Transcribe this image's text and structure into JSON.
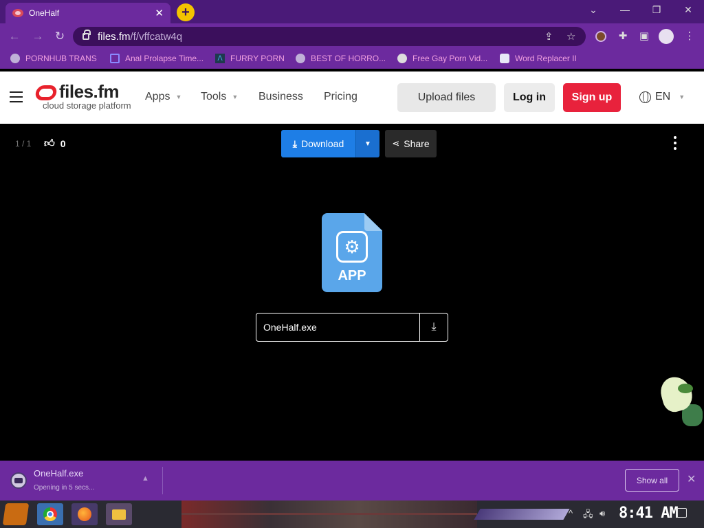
{
  "browser": {
    "tab_title": "OneHalf",
    "tab_close": "✕",
    "new_tab": "+",
    "url_host": "files.fm",
    "url_path": "/f/vffcatw4q"
  },
  "bookmarks": [
    {
      "label": "PORNHUB TRANS",
      "icon": "globe-icon"
    },
    {
      "label": "Anal Prolapse Time...",
      "icon": "bookmark-icon"
    },
    {
      "label": "FURRY PORN",
      "icon": "lambda-icon"
    },
    {
      "label": "BEST OF HORRO...",
      "icon": "globe-icon"
    },
    {
      "label": "Free Gay Porn Vid...",
      "icon": "site-icon"
    },
    {
      "label": "Word Replacer II",
      "icon": "extension-icon"
    }
  ],
  "site": {
    "logo_name": "files.fm",
    "logo_tagline": "cloud storage platform",
    "nav": {
      "apps": "Apps",
      "tools": "Tools",
      "business": "Business",
      "pricing": "Pricing"
    },
    "upload_label": "Upload files",
    "login_label": "Log in",
    "signup_label": "Sign up",
    "lang": "EN",
    "colors": {
      "brand_red": "#e8222c",
      "signup": "#e8223c",
      "download": "#1e7ee6"
    }
  },
  "viewer": {
    "counter": "1 / 1",
    "likes": "0",
    "download_label": "Download",
    "share_label": "Share",
    "file_type_label": "APP",
    "file_name": "OneHalf.exe"
  },
  "shelf": {
    "file_name": "OneHalf.exe",
    "status": "Opening in 5 secs...",
    "show_all": "Show all"
  },
  "taskbar": {
    "clock": "8:41 AM"
  }
}
